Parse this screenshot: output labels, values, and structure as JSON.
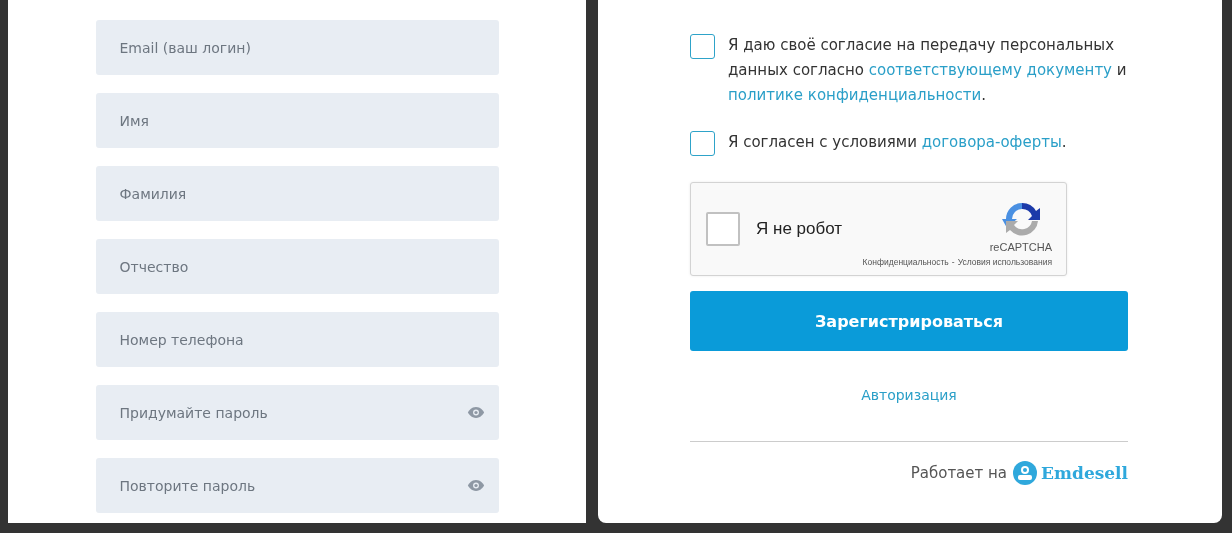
{
  "fields": [
    {
      "kind": "text",
      "placeholder": "Email (ваш логин)"
    },
    {
      "kind": "text",
      "placeholder": "Имя"
    },
    {
      "kind": "text",
      "placeholder": "Фамилия"
    },
    {
      "kind": "text",
      "placeholder": "Отчество"
    },
    {
      "kind": "text",
      "placeholder": "Номер телефона"
    },
    {
      "kind": "password",
      "placeholder": "Придумайте пароль"
    },
    {
      "kind": "password",
      "placeholder": "Повторите пароль"
    }
  ],
  "agreements": [
    {
      "checked": false,
      "parts": [
        {
          "kind": "text",
          "text": "Я даю своё согласие на передачу персональных данных согласно "
        },
        {
          "kind": "link",
          "text": "соответствующему документу"
        },
        {
          "kind": "text",
          "text": " и "
        },
        {
          "kind": "link",
          "text": "политике конфиденциальности"
        },
        {
          "kind": "text",
          "text": "."
        }
      ]
    },
    {
      "checked": false,
      "parts": [
        {
          "kind": "text",
          "text": "Я согласен с условиями "
        },
        {
          "kind": "link",
          "text": "договора-оферты"
        },
        {
          "kind": "text",
          "text": "."
        }
      ]
    }
  ],
  "captcha": {
    "checked": false,
    "label": "Я не робот",
    "brand": "reCAPTCHA",
    "privacy": "Конфиденциальность",
    "separator": "-",
    "terms": "Условия использования"
  },
  "submit": "Зарегистрироваться",
  "login_link": "Авторизация",
  "footer": {
    "text": "Работает на",
    "brand": "Emdesell"
  }
}
